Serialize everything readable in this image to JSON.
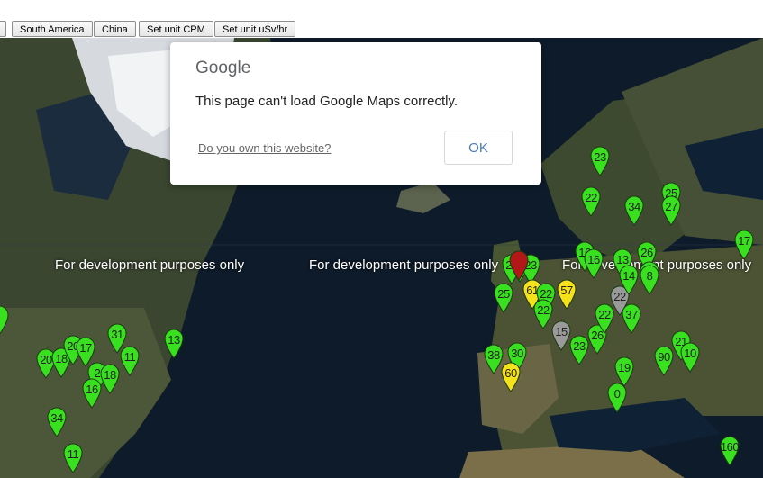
{
  "toolbar": {
    "buttons": [
      "South America",
      "China",
      "Set unit CPM",
      "Set unit uSv/hr"
    ]
  },
  "map": {
    "watermark": "For development purposes only",
    "markers": [
      {
        "label": "23",
        "color": "#39e01f"
      },
      {
        "label": "22",
        "color": "#39e01f"
      },
      {
        "label": "34",
        "color": "#39e01f"
      },
      {
        "label": "25",
        "color": "#39e01f"
      },
      {
        "label": "27",
        "color": "#39e01f"
      },
      {
        "label": "17",
        "color": "#39e01f"
      },
      {
        "label": "16",
        "color": "#39e01f"
      },
      {
        "label": "16",
        "color": "#39e01f"
      },
      {
        "label": "13",
        "color": "#39e01f"
      },
      {
        "label": "26",
        "color": "#39e01f"
      },
      {
        "label": "18",
        "color": "#39e01f"
      },
      {
        "label": "20",
        "color": "#39e01f"
      },
      {
        "label": "21",
        "color": "#39e01f"
      },
      {
        "label": "23",
        "color": "#39e01f"
      },
      {
        "label": "25",
        "color": "#39e01f"
      },
      {
        "label": "61",
        "color": "#f5e21b"
      },
      {
        "label": "57",
        "color": "#f5e21b"
      },
      {
        "label": "22",
        "color": "#39e01f"
      },
      {
        "label": "22",
        "color": "#9a9a9a"
      },
      {
        "label": "14",
        "color": "#39e01f"
      },
      {
        "label": "8",
        "color": "#39e01f"
      },
      {
        "label": "22",
        "color": "#39e01f"
      },
      {
        "label": "37",
        "color": "#39e01f"
      },
      {
        "label": "15",
        "color": "#9a9a9a"
      },
      {
        "label": "23",
        "color": "#39e01f"
      },
      {
        "label": "26",
        "color": "#39e01f"
      },
      {
        "label": "22",
        "color": "#39e01f"
      },
      {
        "label": "38",
        "color": "#39e01f"
      },
      {
        "label": "30",
        "color": "#39e01f"
      },
      {
        "label": "60",
        "color": "#f5e21b"
      },
      {
        "label": "19",
        "color": "#39e01f"
      },
      {
        "label": "0",
        "color": "#39e01f"
      },
      {
        "label": "90",
        "color": "#39e01f"
      },
      {
        "label": "21",
        "color": "#39e01f"
      },
      {
        "label": "10",
        "color": "#39e01f"
      },
      {
        "label": "160",
        "color": "#39e01f"
      },
      {
        "label": "31",
        "color": "#39e01f"
      },
      {
        "label": "13",
        "color": "#39e01f"
      },
      {
        "label": "20",
        "color": "#39e01f"
      },
      {
        "label": "18",
        "color": "#39e01f"
      },
      {
        "label": "20",
        "color": "#39e01f"
      },
      {
        "label": "17",
        "color": "#39e01f"
      },
      {
        "label": "11",
        "color": "#39e01f"
      },
      {
        "label": "2",
        "color": "#39e01f"
      },
      {
        "label": "18",
        "color": "#39e01f"
      },
      {
        "label": "16",
        "color": "#39e01f"
      },
      {
        "label": "34",
        "color": "#39e01f"
      },
      {
        "label": "11",
        "color": "#39e01f"
      },
      {
        "label": "",
        "color": "#39e01f"
      },
      {
        "label": "",
        "color": "#b21818"
      }
    ]
  },
  "dialog": {
    "logo": "Google",
    "message": "This page can't load Google Maps correctly.",
    "link": "Do you own this website?",
    "ok": "OK"
  }
}
